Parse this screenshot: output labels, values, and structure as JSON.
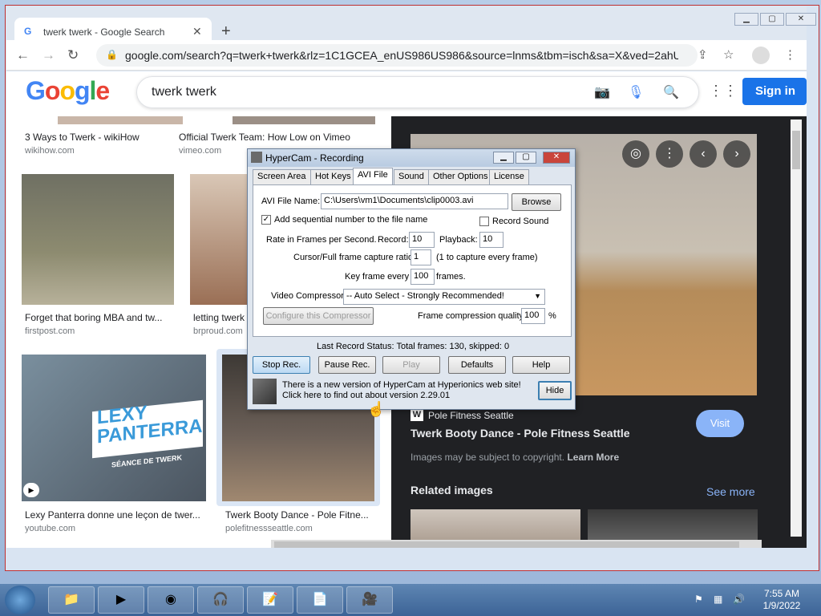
{
  "browser": {
    "tab_title": "twerk twerk - Google Search",
    "tab_favicon": "G",
    "new_tab": "+",
    "url": "google.com/search?q=twerk+twerk&rlz=1C1GCEA_enUS986US986&source=lnms&tbm=isch&sa=X&ved=2ahU..."
  },
  "google": {
    "logo": "Google",
    "query": "twerk twerk",
    "sign_in": "Sign in"
  },
  "results": [
    {
      "caption": "3 Ways to Twerk - wikiHow",
      "source": "wikihow.com"
    },
    {
      "caption": "Official Twerk Team: How Low on Vimeo",
      "source": "vimeo.com"
    },
    {
      "caption": "Forget that boring MBA and tw...",
      "source": "firstpost.com"
    },
    {
      "caption": "letting twerk",
      "source": "brproud.com"
    },
    {
      "caption": "Lexy Panterra donne une leçon de twer...",
      "source": "youtube.com",
      "overlay_title": "LEXY PANTERRA",
      "overlay_sub": "SÉANCE DE TWERK"
    },
    {
      "caption": "Twerk Booty Dance - Pole Fitne...",
      "source": "polefitnessseattle.com"
    }
  ],
  "preview": {
    "site": "Pole Fitness Seattle",
    "title": "Twerk Booty Dance - Pole Fitness Seattle",
    "visit": "Visit",
    "copyright": "Images may be subject to copyright.",
    "learn_more": "Learn More",
    "related": "Related images",
    "see_more": "See more"
  },
  "hypercam": {
    "title": "HyperCam - Recording",
    "tabs": [
      "Screen Area",
      "Hot Keys",
      "AVI File",
      "Sound",
      "Other Options",
      "License"
    ],
    "selected_tab": "AVI File",
    "file_label": "AVI File Name:",
    "file_value": "C:\\Users\\vm1\\Documents\\clip0003.avi",
    "browse": "Browse",
    "seq_label": "Add sequential number to the file name",
    "seq_checked": true,
    "sound_label": "Record Sound",
    "sound_checked": false,
    "rate_label": "Rate in Frames per Second.",
    "record_label": "Record:",
    "record_value": "10",
    "playback_label": "Playback:",
    "playback_value": "10",
    "ratio_label": "Cursor/Full frame capture ratio",
    "ratio_value": "1",
    "ratio_note": "(1 to capture every frame)",
    "keyframe_label": "Key frame every",
    "keyframe_value": "100",
    "keyframe_unit": "frames.",
    "compressor_label": "Video Compressor:",
    "compressor_value": "-- Auto Select - Strongly Recommended!",
    "configure": "Configure this Compressor",
    "quality_label": "Frame compression quality",
    "quality_value": "100",
    "quality_unit": "%",
    "status": "Last Record Status: Total frames: 130, skipped: 0",
    "buttons": {
      "stop": "Stop Rec.",
      "pause": "Pause Rec.",
      "play": "Play",
      "defaults": "Defaults",
      "help": "Help",
      "hide": "Hide"
    },
    "notice": "There is a new version of HyperCam at Hyperionics web site! Click here to find out about version 2.29.01"
  },
  "taskbar": {
    "time": "7:55 AM",
    "date": "1/9/2022"
  }
}
